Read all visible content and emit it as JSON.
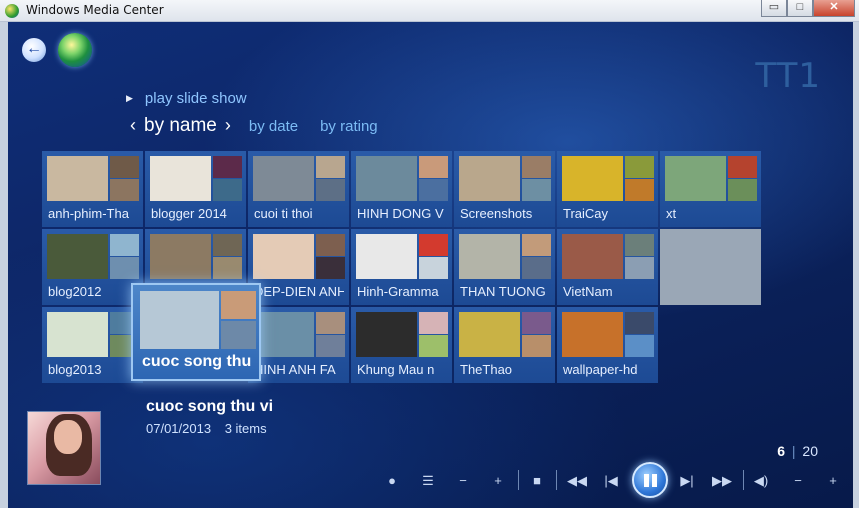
{
  "window": {
    "title": "Windows Media Center",
    "controls": {
      "minimize": "▭",
      "maximize": "□",
      "close": "✕"
    }
  },
  "library_title": "TT1",
  "play_slide_show": "play slide show",
  "sort": {
    "active": "by name",
    "options": [
      "by date",
      "by rating"
    ],
    "prev": "‹",
    "next": "›"
  },
  "folders": [
    {
      "label": "anh-phim-Tha",
      "main": "#c9b8a0",
      "s1": "#6f5a48",
      "s2": "#8c7560"
    },
    {
      "label": "blogger 2014",
      "main": "#e9e4da",
      "s1": "#5c2a4a",
      "s2": "#3d6a8a"
    },
    {
      "label": "cuoi ti thoi",
      "main": "#7e8a96",
      "s1": "#b8a68f",
      "s2": "#5d6f86"
    },
    {
      "label": "HINH DONG V",
      "main": "#6c8a9c",
      "s1": "#c99a7a",
      "s2": "#4b6fa0"
    },
    {
      "label": "Screenshots",
      "main": "#b9a78c",
      "s1": "#9a7d66",
      "s2": "#6d8fa3"
    },
    {
      "label": "TraiCay",
      "main": "#d8b42a",
      "s1": "#8a9a3a",
      "s2": "#c07a2a"
    },
    {
      "label": "xt",
      "main": "#7da67a",
      "s1": "#b5432e",
      "s2": "#6b8f5a"
    },
    {
      "label": "blog2012",
      "main": "#4a5a3a",
      "s1": "#8fb5cf",
      "s2": "#6e8faf"
    },
    {
      "label": "",
      "main": "#8c7a63",
      "s1": "#6f6655",
      "s2": "#998a6f"
    },
    {
      "label": "DEP-DIEN ANH",
      "main": "#e4cbb6",
      "s1": "#7d5f4f",
      "s2": "#3a2f3a"
    },
    {
      "label": "Hinh-Gramma",
      "main": "#e8e8e8",
      "s1": "#d33a2e",
      "s2": "#c8d3dc"
    },
    {
      "label": "THAN TUONG",
      "main": "#b3b4a8",
      "s1": "#c29b7a",
      "s2": "#5a6d8a"
    },
    {
      "label": "VietNam",
      "main": "#9a5a48",
      "s1": "#6b7f7a",
      "s2": "#8b9eb3"
    },
    {
      "label": "",
      "main": "#9aa7b6",
      "s1": "#9aa7b6",
      "s2": "#9aa7b6",
      "solo": true
    },
    {
      "label": "blog2013",
      "main": "#d7e3d0",
      "s1": "#4f7c9e",
      "s2": "#6f8a5e"
    },
    {
      "label": "cuoc song thu",
      "main": "#b6c8d6",
      "s1": "#c99b78",
      "s2": "#6d89a8",
      "focus": true
    },
    {
      "label": "HINH ANH FA",
      "main": "#6a8fa7",
      "s1": "#a88f7d",
      "s2": "#6f7f9a"
    },
    {
      "label": "Khung Mau n",
      "main": "#2c2c2c",
      "s1": "#d6b3b6",
      "s2": "#9dbf6a"
    },
    {
      "label": "TheThao",
      "main": "#c9b245",
      "s1": "#7a5a8c",
      "s2": "#b88f6a"
    },
    {
      "label": "wallpaper-hd",
      "main": "#c7712a",
      "s1": "#3a4a6a",
      "s2": "#5b8fc7"
    }
  ],
  "selected": {
    "title": "cuoc song thu vi",
    "date": "07/01/2013",
    "count": "3 items"
  },
  "pager": {
    "current": "6",
    "divider": "|",
    "total": "20"
  },
  "transport": {
    "dot": "●",
    "list": "☰",
    "minus": "−",
    "plus": "+",
    "stop": "■",
    "rewind": "◀◀",
    "prev": "|◀",
    "next": "▶|",
    "forward": "▶▶",
    "volume": "◀)",
    "vol_minus": "−",
    "vol_plus": "+"
  }
}
